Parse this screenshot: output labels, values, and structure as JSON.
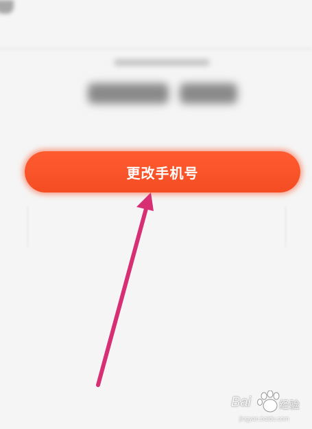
{
  "screen": {
    "background_color": "#f5f5f5"
  },
  "blurred_content": {
    "hint_text": "",
    "phone_number": ""
  },
  "change_phone_button": {
    "label": "更改手机号",
    "color": "#f44d24"
  },
  "annotation_arrow": {
    "color": "#d62f74",
    "points_to": "change-phone-button"
  },
  "watermark": {
    "brand": "Bai",
    "product": "经验",
    "url": "jingyan.baidu.com"
  }
}
